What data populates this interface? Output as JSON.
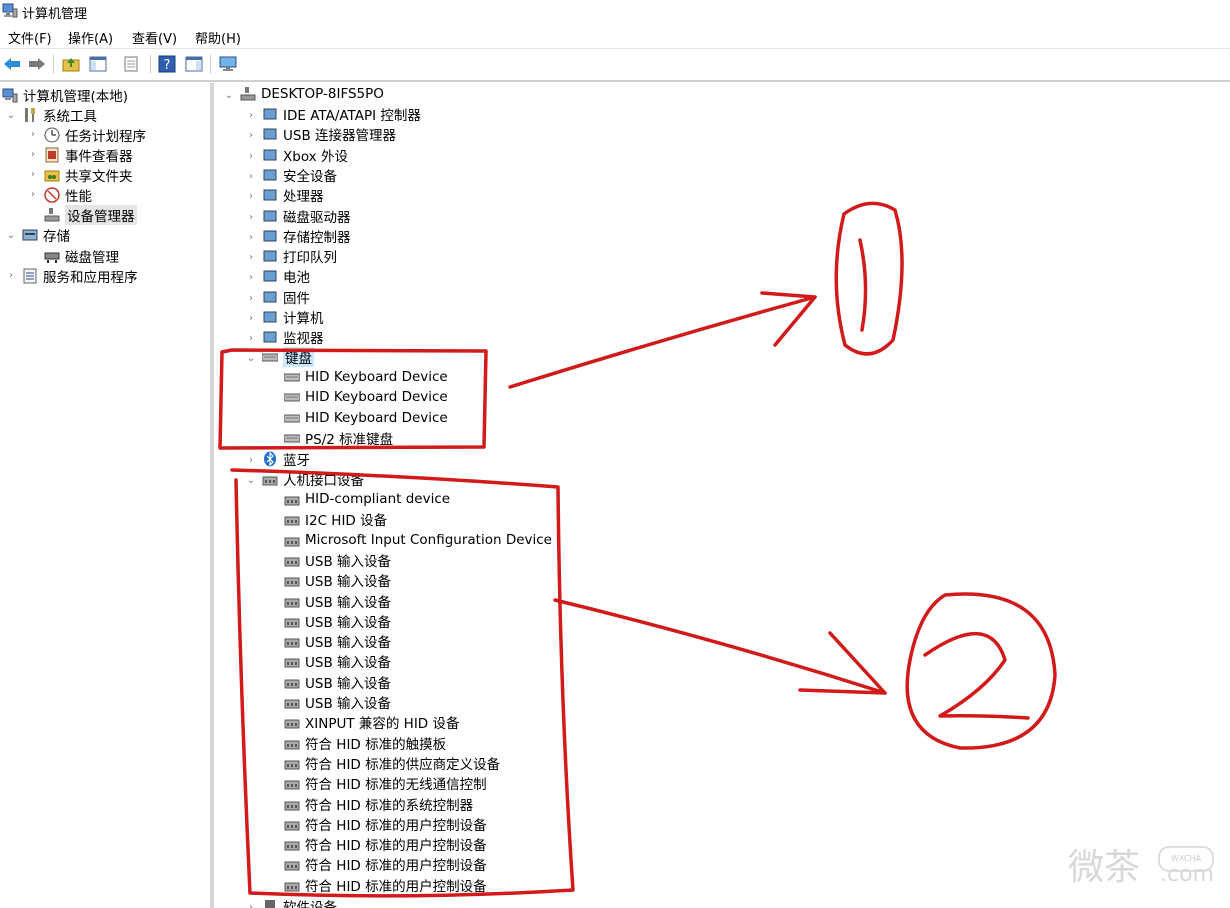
{
  "window": {
    "title": "计算机管理"
  },
  "menu": [
    "文件(F)",
    "操作(A)",
    "查看(V)",
    "帮助(H)"
  ],
  "toolbar_icons": [
    "back-arrow-icon",
    "forward-arrow-icon",
    "up-folder-icon",
    "show-tree-icon",
    "properties-icon",
    "help-icon",
    "action-pane-icon",
    "monitor-icon"
  ],
  "left_tree": [
    {
      "label": "计算机管理(本地)",
      "icon": "computer-management-icon"
    },
    {
      "label": "系统工具",
      "icon": "tools-icon"
    },
    {
      "label": "任务计划程序",
      "icon": "clock-icon"
    },
    {
      "label": "事件查看器",
      "icon": "event-viewer-icon"
    },
    {
      "label": "共享文件夹",
      "icon": "shared-folder-icon"
    },
    {
      "label": "性能",
      "icon": "performance-icon"
    },
    {
      "label": "设备管理器",
      "icon": "device-manager-icon"
    },
    {
      "label": "存储",
      "icon": "storage-icon"
    },
    {
      "label": "磁盘管理",
      "icon": "disk-management-icon"
    },
    {
      "label": "服务和应用程序",
      "icon": "services-icon"
    }
  ],
  "device_tree": {
    "root": "DESKTOP-8IFS5PO",
    "categories": [
      "IDE ATA/ATAPI 控制器",
      "USB 连接器管理器",
      "Xbox 外设",
      "安全设备",
      "处理器",
      "磁盘驱动器",
      "存储控制器",
      "打印队列",
      "电池",
      "固件",
      "计算机",
      "监视器"
    ],
    "keyboard": {
      "label": "键盘",
      "children": [
        "HID Keyboard Device",
        "HID Keyboard Device",
        "HID Keyboard Device",
        "PS/2 标准键盘"
      ]
    },
    "bluetooth": "蓝牙",
    "hid": {
      "label": "人机接口设备",
      "children": [
        "HID-compliant device",
        "I2C HID 设备",
        "Microsoft Input Configuration Device",
        "USB 输入设备",
        "USB 输入设备",
        "USB 输入设备",
        "USB 输入设备",
        "USB 输入设备",
        "USB 输入设备",
        "USB 输入设备",
        "USB 输入设备",
        "XINPUT 兼容的 HID 设备",
        "符合 HID 标准的触摸板",
        "符合 HID 标准的供应商定义设备",
        "符合 HID 标准的无线通信控制",
        "符合 HID 标准的系统控制器",
        "符合 HID 标准的用户控制设备",
        "符合 HID 标准的用户控制设备",
        "符合 HID 标准的用户控制设备",
        "符合 HID 标准的用户控制设备"
      ]
    },
    "last_partial": "软件设备"
  },
  "annotations": {
    "label_1": "1",
    "label_2": "2",
    "color": "#d11a1a"
  },
  "watermark": {
    "text": "微茶",
    "badge": "WXCHA",
    "suffix": ".com"
  }
}
